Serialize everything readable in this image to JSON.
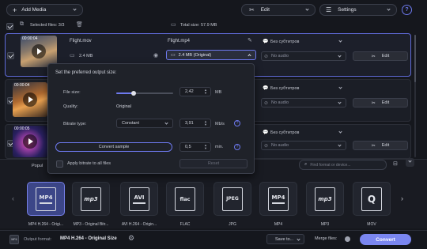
{
  "toolbar": {
    "add_media": "Add Media",
    "edit": "Edit",
    "settings": "Settings",
    "help": "?"
  },
  "status": {
    "selected_files": "Selected files: 3/3",
    "total_size": "Total size: 57.9 MB"
  },
  "files": [
    {
      "timecode": "00:00:04",
      "source_name": "Flight.mov",
      "source_size": "2.4 MB",
      "output_name": "Flight.mp4",
      "output_size": "2.4 MB (Original)",
      "subtitles": "Без субтитров",
      "audio": "No audio",
      "edit": "Edit"
    },
    {
      "timecode": "00:00:04",
      "subtitles": "Без субтитров",
      "audio": "No audio",
      "edit": "Edit"
    },
    {
      "timecode": "00:00:05",
      "subtitles": "Без субтитров",
      "audio": "No audio",
      "edit": "Edit"
    }
  ],
  "popup": {
    "title": "Set the preferred output size:",
    "file_size_label": "File size:",
    "file_size_value": "2,42",
    "file_size_unit": "MB",
    "file_size_slider_fraction": 0.3,
    "quality_label": "Quality:",
    "quality_value": "Original",
    "bitrate_label": "Bitrate type:",
    "bitrate_type": "Constant",
    "bitrate_value": "3,91",
    "bitrate_unit": "Mb/s",
    "convert_sample": "Convert sample",
    "sample_value": "0,5",
    "sample_unit": "min.",
    "apply_all": "Apply bitrate to all files",
    "reset": "Reset"
  },
  "formats": {
    "popular_tab": "Popul",
    "search_placeholder": "Find format or device...",
    "items": [
      {
        "icon": "MP4",
        "label": "MP4 H.264 - Origi..."
      },
      {
        "icon": "mp3",
        "label": "MP3 - Original Bitr..."
      },
      {
        "icon": "AVI",
        "label": "AVI H.264 - Origin..."
      },
      {
        "icon": "flac",
        "label": "FLAC"
      },
      {
        "icon": "JPEG",
        "label": "JPG"
      },
      {
        "icon": "MP4",
        "label": "MP4"
      },
      {
        "icon": "mp3",
        "label": "MP3"
      },
      {
        "icon": "mov-icon",
        "label": "MOV"
      }
    ]
  },
  "footer": {
    "output_format_label": "Output format:",
    "output_format_value": "MP4 H.264 - Original Size",
    "save_to": "Save to...",
    "merge_files": "Merge files:",
    "convert": "Convert"
  },
  "colors": {
    "accent": "#6d79ee",
    "convert_button": "#7a86f0",
    "background": "#15171d"
  }
}
